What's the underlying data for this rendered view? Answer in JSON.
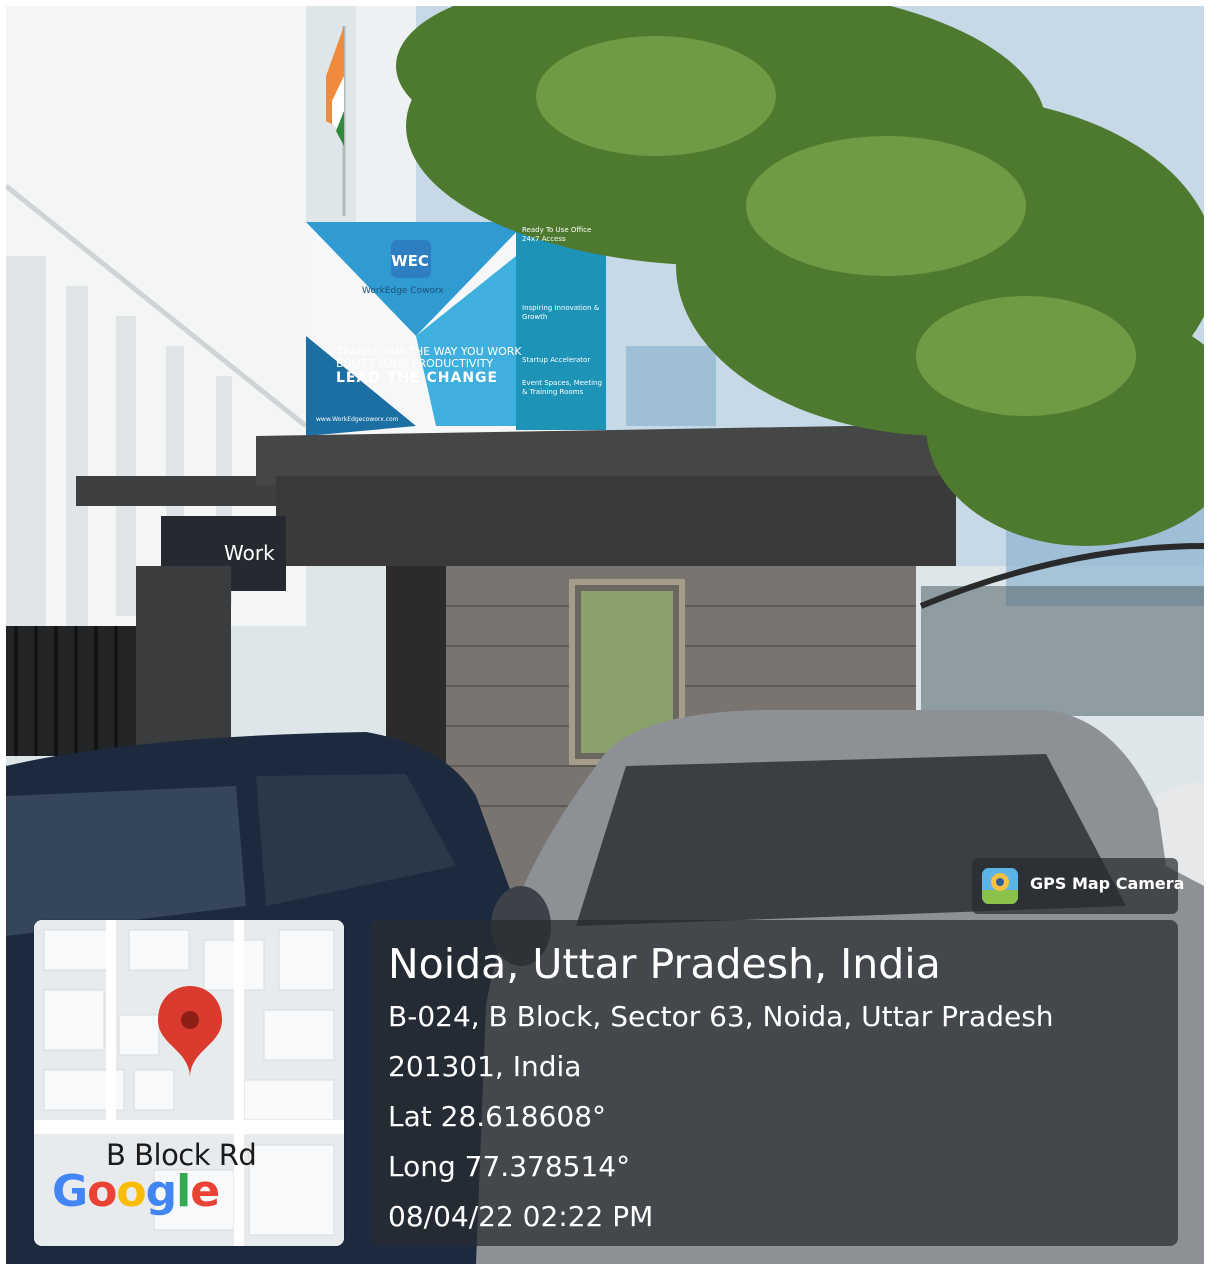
{
  "photo": {
    "billboard": {
      "brand_short": "WEC",
      "brand_name": "WorkEdge Coworx",
      "tagline_line1": "TRANSFORM THE WAY YOU WORK",
      "tagline_line2": "BOOST YOUR PRODUCTIVITY",
      "tagline_line3": "LEAD THE CHANGE",
      "website": "www.WorkEdgecoworx.com",
      "side_items": [
        "Ready To Use Office",
        "24x7 Access",
        "Inspiring Innovation & Growth",
        "Startup Accelerator",
        "Event Spaces, Meeting & Training Rooms"
      ]
    },
    "entrance_sign": "Work"
  },
  "map": {
    "street_label": "B Block Rd",
    "logo_text": "Google",
    "pin_color": "#DB3A2F"
  },
  "overlay": {
    "badge_label": "GPS Map Camera",
    "title": "Noida, Uttar Pradesh, India",
    "address_line1": "B-024, B Block, Sector 63, Noida, Uttar Pradesh",
    "address_line2": "201301, India",
    "latitude": "Lat 28.618608°",
    "longitude": "Long 77.378514°",
    "datetime": "08/04/22 02:22 PM"
  }
}
